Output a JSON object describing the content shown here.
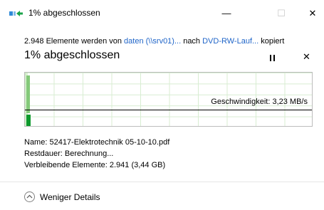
{
  "window": {
    "title": "1% abgeschlossen",
    "minimize_glyph": "—",
    "maximize_glyph": "☐",
    "close_glyph": "✕"
  },
  "summary": {
    "prefix": "2.948 Elemente werden von ",
    "source_link": "daten (\\\\srv01)...",
    "middle": " nach ",
    "destination_link": "DVD-RW-Lauf...",
    "suffix": " kopiert",
    "link_color": "#1e64c8"
  },
  "progress": {
    "title": "1% abgeschlossen",
    "percent": 1,
    "pause_icon": "pause-icon",
    "cancel_glyph": "✕"
  },
  "graph": {
    "speed_label": "Geschwindigkeit: 3,23 MB/s",
    "fill_color": "#bde6b1",
    "bar_color": "#0e9a2e"
  },
  "details": {
    "name_label": "Name:",
    "name_value": "52417-Elektrotechnik 05-10-10.pdf",
    "remaining_time_label": "Restdauer:",
    "remaining_time_value": "Berechnung...",
    "remaining_items_label": "Verbleibende Elemente:",
    "remaining_items_value": "2.941 (3,44 GB)"
  },
  "footer": {
    "less_details_label": "Weniger Details"
  }
}
